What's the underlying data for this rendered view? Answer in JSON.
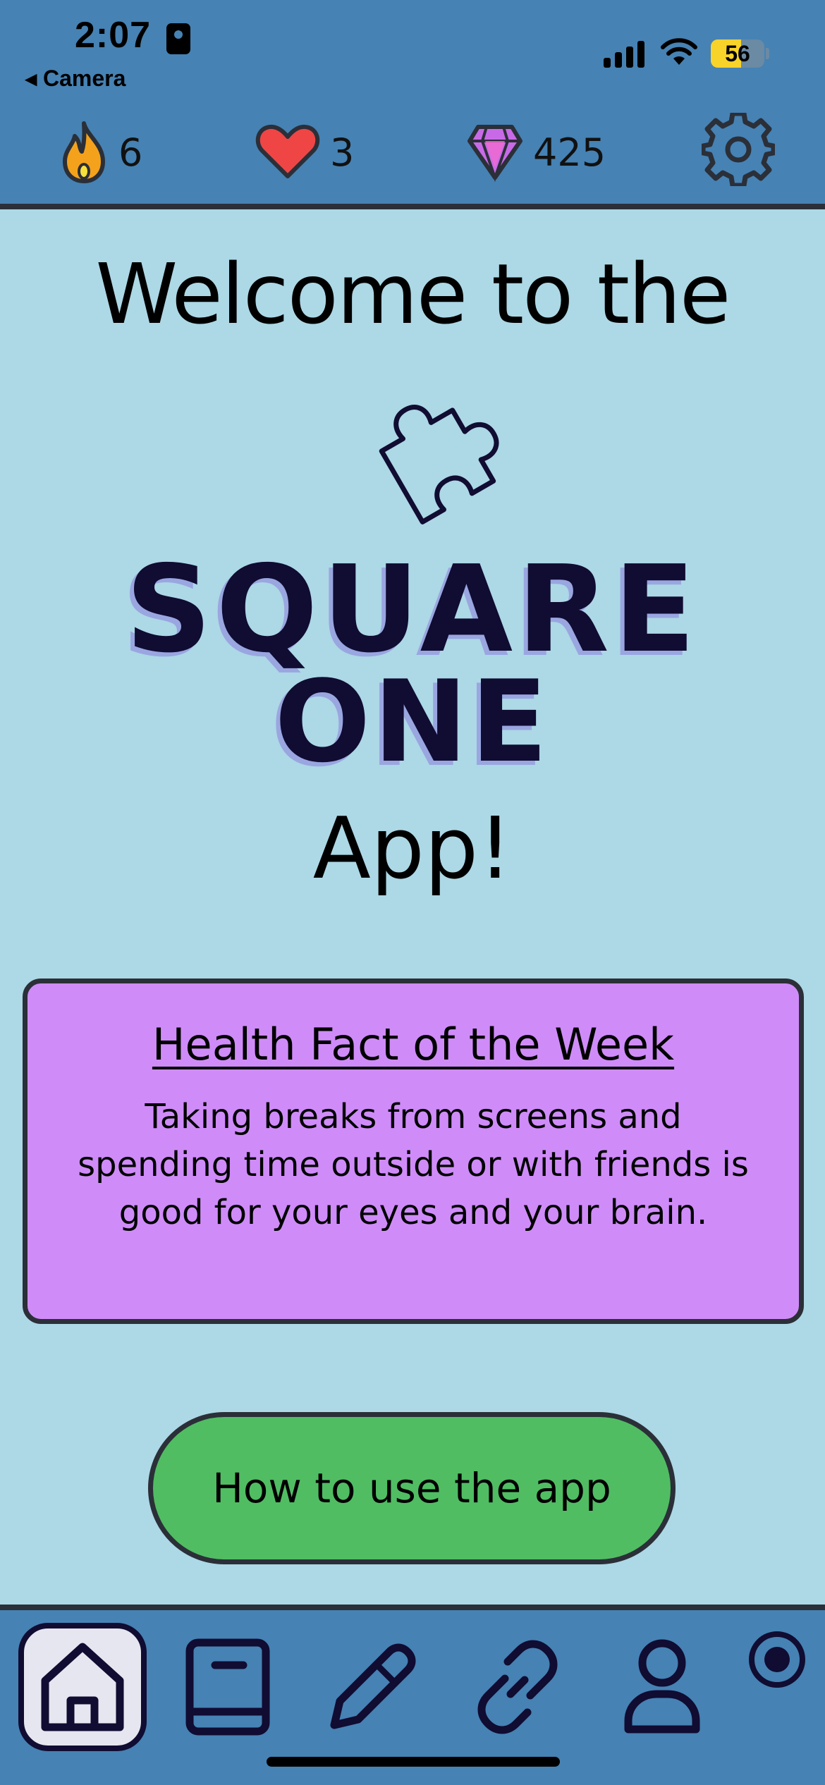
{
  "status_bar": {
    "time": "2:07",
    "back_label": "◂ Camera",
    "battery_percent": "56",
    "battery_level": 0.56
  },
  "stats": {
    "streak": {
      "icon": "flame-icon",
      "value": "6"
    },
    "lives": {
      "icon": "heart-icon",
      "value": "3"
    },
    "gems": {
      "icon": "gem-icon",
      "value": "425"
    },
    "settings_icon": "gear-icon"
  },
  "main": {
    "welcome_text": "Welcome to the",
    "logo_line1": "SQUARE",
    "logo_line2": "ONE",
    "app_text": "App!"
  },
  "fact_card": {
    "title": "Health Fact of the Week",
    "body": "Taking breaks from screens and spending time outside or with friends is good for your eyes and your brain."
  },
  "how_button": {
    "label": "How to use the app"
  },
  "tabbar": {
    "tabs": [
      {
        "icon": "home-icon",
        "active": true
      },
      {
        "icon": "book-icon",
        "active": false
      },
      {
        "icon": "pencil-icon",
        "active": false
      },
      {
        "icon": "link-icon",
        "active": false
      },
      {
        "icon": "profile-icon",
        "active": false
      }
    ],
    "record_icon": "record-icon"
  },
  "colors": {
    "header_bg": "#4682b4",
    "page_bg": "#add8e6",
    "card_bg": "#cf8cf8",
    "button_bg": "#50bd63",
    "logo_text": "#100c32"
  }
}
